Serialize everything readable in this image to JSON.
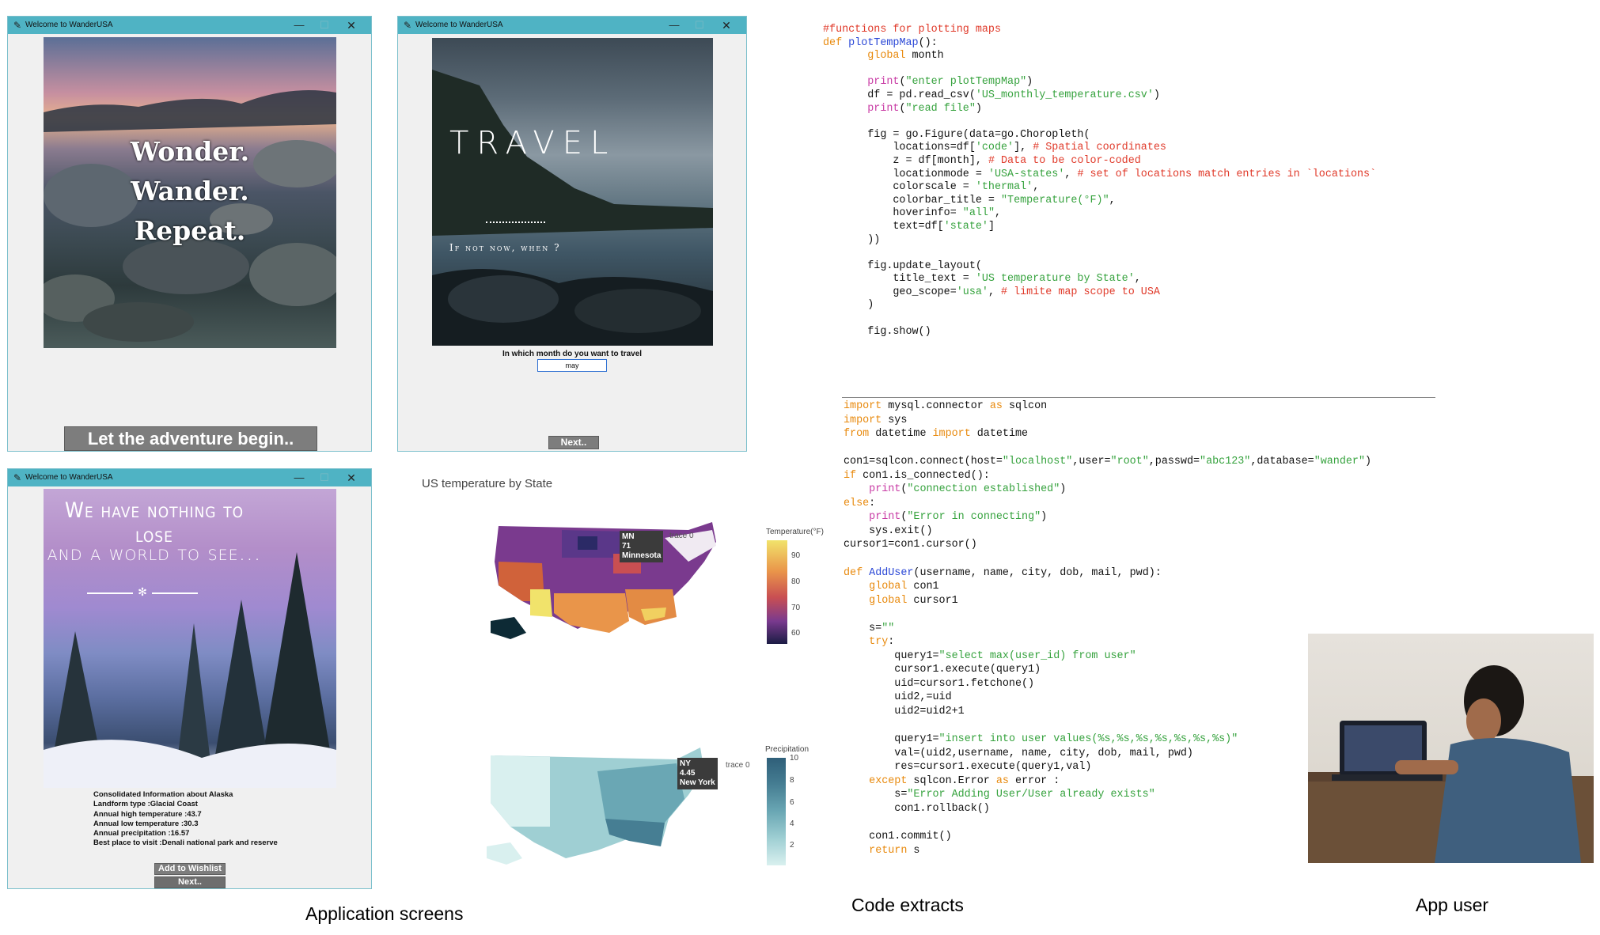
{
  "windows": {
    "title": "Welcome to WanderUSA"
  },
  "screen1": {
    "poster_lines": [
      "Wonder.",
      "Wander.",
      "Repeat."
    ],
    "button": "Let the adventure begin.."
  },
  "screen2": {
    "poster_title": "TRAVEL",
    "poster_sub": "If not now, when ?",
    "prompt": "In which month do you want to travel",
    "input_value": "may",
    "next_button": "Next.."
  },
  "screen3": {
    "poster_line1": "We have nothing to lose",
    "poster_line2": "and a world to see...",
    "info": [
      "Consolidated Information about Alaska",
      "Landform type :Glacial Coast",
      "Annual high temperature :43.7",
      "Annual low temperature :30.3",
      "Annual precipitation :16.57",
      "Best place to visit :Denali national park and reserve"
    ],
    "wishlist_button": "Add to Wishlist",
    "next_button": "Next.."
  },
  "map1": {
    "title": "US temperature by State",
    "tooltip": [
      "MN",
      "71",
      "Minnesota"
    ],
    "trace": "trace 0",
    "colorbar_title": "Temperature(°F)",
    "ticks": [
      "90",
      "80",
      "70",
      "60"
    ],
    "colors": [
      "#f1e36b",
      "#e9954a",
      "#c94f52",
      "#7a3a8e",
      "#2b2a66"
    ]
  },
  "map2": {
    "tooltip": [
      "NY",
      "4.45",
      "New York"
    ],
    "trace": "trace 0",
    "colorbar_title": "Precipitation",
    "ticks": [
      "10",
      "8",
      "6",
      "4",
      "2"
    ],
    "colors": [
      "#d9f0ef",
      "#9fcfd3",
      "#6aa7b4",
      "#467e93"
    ]
  },
  "captions": {
    "app_screens": "Application screens",
    "code_extracts": "Code extracts",
    "app_user": "App user"
  }
}
